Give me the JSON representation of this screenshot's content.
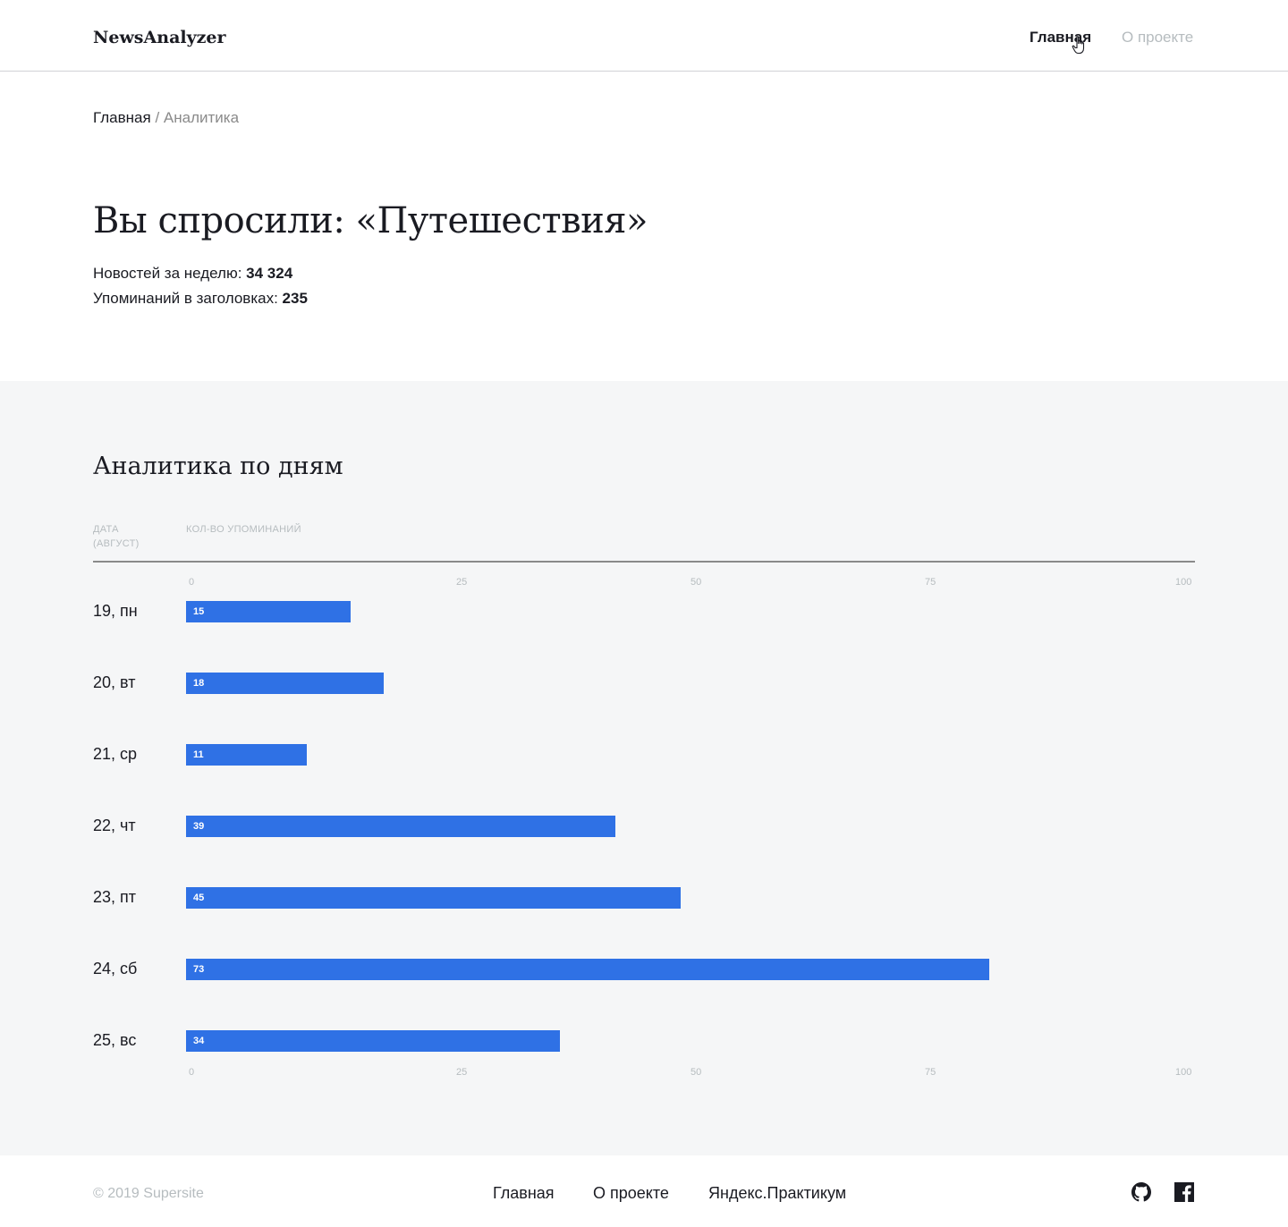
{
  "header": {
    "logo": "NewsAnalyzer",
    "nav_main": "Главная",
    "nav_about": "О проекте"
  },
  "breadcrumb": {
    "home": "Главная",
    "separator": "/",
    "current": "Аналитика"
  },
  "summary": {
    "title": "Вы спросили: «Путешествия»",
    "news_label": "Новостей за неделю: ",
    "news_value": "34 324",
    "mentions_label": "Упоминаний в заголовках: ",
    "mentions_value": "235"
  },
  "analytics": {
    "title": "Аналитика по дням",
    "col_date_line1": "Дата",
    "col_date_line2": "(август)",
    "col_count": "Кол-во упоминаний"
  },
  "chart_data": {
    "type": "bar",
    "orientation": "horizontal",
    "categories": [
      "19, пн",
      "20, вт",
      "21, ср",
      "22, чт",
      "23, пт",
      "24, сб",
      "25, вс"
    ],
    "values": [
      15,
      18,
      11,
      39,
      45,
      73,
      34
    ],
    "xlim": [
      0,
      100
    ],
    "ticks": [
      "0",
      "25",
      "50",
      "75",
      "100"
    ],
    "bar_color": "#2f71e5",
    "grid": false
  },
  "footer": {
    "copyright": "© 2019  Supersite",
    "link_home": "Главная",
    "link_about": "О проекте",
    "link_yp": "Яндекс.Практикум",
    "social_icons": [
      "github-icon",
      "facebook-icon"
    ]
  },
  "colors": {
    "accent": "#2f71e5",
    "text": "#1a1b22",
    "muted": "#b6bcbf",
    "section_bg": "#f5f6f7"
  }
}
